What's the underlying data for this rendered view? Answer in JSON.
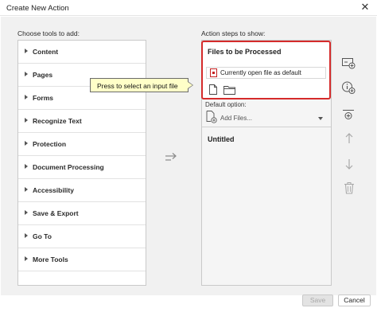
{
  "window": {
    "title": "Create New Action",
    "close_glyph": "✕"
  },
  "left": {
    "heading": "Choose tools to add:",
    "tools": [
      {
        "label": "Content"
      },
      {
        "label": "Pages"
      },
      {
        "label": "Forms"
      },
      {
        "label": "Recognize Text"
      },
      {
        "label": "Protection"
      },
      {
        "label": "Document Processing"
      },
      {
        "label": "Accessibility"
      },
      {
        "label": "Save & Export"
      },
      {
        "label": "Go To"
      },
      {
        "label": "More Tools"
      }
    ]
  },
  "right": {
    "heading": "Action steps to show:",
    "files_section": {
      "title": "Files to be Processed",
      "default_file_text": "Currently open file as default"
    },
    "tooltip": "Press to select an input file",
    "default_option_label": "Default option:",
    "add_files_placeholder": "Add Files...",
    "untitled_label": "Untitled"
  },
  "footer": {
    "save_label": "Save",
    "cancel_label": "Cancel"
  },
  "colors": {
    "highlight": "#d52b2b",
    "tooltip_bg": "#ffffc8",
    "pdf_red": "#c52222"
  }
}
